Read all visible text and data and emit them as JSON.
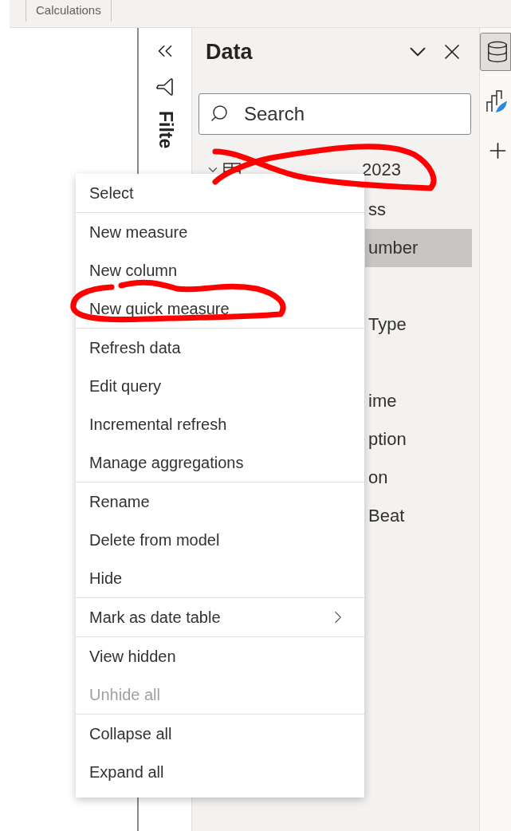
{
  "ribbon": {
    "tab": "Calculations"
  },
  "filters_pane": {
    "label": "Filte"
  },
  "data_pane": {
    "title": "Data",
    "search": {
      "placeholder": "Search"
    },
    "table": {
      "name": "2023",
      "expanded": true
    },
    "fields": [
      {
        "kind": "field",
        "label": "ss",
        "selected": false
      },
      {
        "kind": "field",
        "label": "umber",
        "selected": true
      },
      {
        "kind": "covered"
      },
      {
        "kind": "field",
        "label": "Type",
        "selected": false
      },
      {
        "kind": "covered"
      },
      {
        "kind": "field",
        "label": "ime",
        "selected": false
      },
      {
        "kind": "field",
        "label": "ption",
        "selected": false
      },
      {
        "kind": "field",
        "label": "on",
        "selected": false
      },
      {
        "kind": "field",
        "label": "Beat",
        "selected": false
      }
    ]
  },
  "rail": [
    {
      "kind": "data",
      "selected": true
    },
    {
      "kind": "format",
      "selected": false
    },
    {
      "kind": "add",
      "selected": false
    }
  ],
  "context_menu": [
    [
      {
        "label": "Select",
        "disabled": false
      }
    ],
    [
      {
        "label": "New measure",
        "disabled": false
      },
      {
        "label": "New column",
        "disabled": false
      },
      {
        "label": "New quick measure",
        "disabled": false
      }
    ],
    [
      {
        "label": "Refresh data",
        "disabled": false
      },
      {
        "label": "Edit query",
        "disabled": false
      },
      {
        "label": "Incremental refresh",
        "disabled": false
      },
      {
        "label": "Manage aggregations",
        "disabled": false
      }
    ],
    [
      {
        "label": "Rename",
        "disabled": false
      },
      {
        "label": "Delete from model",
        "disabled": false
      },
      {
        "label": "Hide",
        "disabled": false
      }
    ],
    [
      {
        "label": "Mark as date table",
        "disabled": false,
        "submenu": true
      }
    ],
    [
      {
        "label": "View hidden",
        "disabled": false
      },
      {
        "label": "Unhide all",
        "disabled": true
      }
    ],
    [
      {
        "label": "Collapse all",
        "disabled": false
      },
      {
        "label": "Expand all",
        "disabled": false
      }
    ]
  ],
  "annotations": [
    {
      "kind": "strike"
    },
    {
      "kind": "circle"
    }
  ]
}
